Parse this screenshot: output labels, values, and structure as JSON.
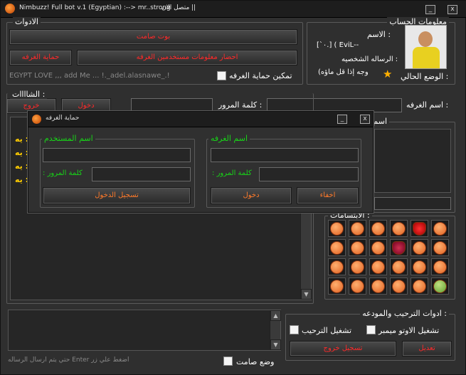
{
  "window": {
    "title": "Nimbuzz! Full bot v.1 (Egyptian) :--> mr..strong",
    "status": "متصل الان ||",
    "min_label": "_",
    "close_label": "x"
  },
  "tools": {
    "legend": "الادوات",
    "silent_bot_label": "بوت صامت",
    "room_users_info_label": "احضار معلومات مستخدمين الغرفه",
    "room_protect_label": "حماية الغرفه",
    "marquee": "EGYPT LOVE ,,, add Me   ...   !._adel.alasnawe_.!",
    "enable_room_protect_label": "تمكين حماية الغرفه"
  },
  "account": {
    "legend": "معلومات الحساب",
    "name_label": "الاسم :",
    "name_value": "[`٠.] ( EviL--",
    "status_msg_label": "الرساله الشخصيه :",
    "status_msg_value": "(وجه إذا قل ماؤه",
    "current_state_label": "الوضع الحالي :"
  },
  "room": {
    "room_name_label": "اسم الغرفه :",
    "password_label": "كلمة المرور :",
    "enter_label": "دخول",
    "exit_label": "خروج",
    "chats_legend": "الشاااات :",
    "room_list_partial": "اسم",
    "rows": [
      "يه :",
      "يه :",
      "يه :",
      "يه :"
    ]
  },
  "smileys": {
    "legend": "الابتسامات :"
  },
  "welcome": {
    "legend": "ادوات الترحيب والمودعه :",
    "auto_member_label": "تشغيل الاوتو ميمبر",
    "welcome_label": "تشغيل الترحيب",
    "edit_label": "تعديل",
    "logout_label": "تسجيل خروج"
  },
  "bottom": {
    "hint": "حتي يتم ارسال الرساله Enter اضغط علي زر",
    "silent_mode_label": "وضع صامت"
  },
  "dialog": {
    "title": "حماية الغرفه",
    "min_label": "_",
    "close_label": "x",
    "user_legend": "اسم المستخدم",
    "user_password_label": ": كلمة المرور",
    "login_label": "تسجيل الدخول",
    "room_legend": "اسم الغرفه",
    "room_password_label": ": كلمة المرور",
    "enter_label": "دخول",
    "hide_label": "اخفاء"
  },
  "colors": {
    "accent_red": "#ff2a2a",
    "accent_green": "#18d418",
    "bg": "#2f2f2f"
  }
}
